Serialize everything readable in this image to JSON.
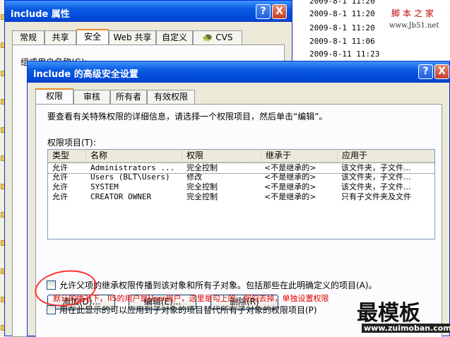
{
  "background_list": {
    "rows": [
      "2009-8-1 11:20",
      "2009-8-1 11:20",
      "2009-8-1 11:06",
      "2009-8-11 11:23"
    ],
    "watermark_text": "脚本之家",
    "watermark_url": "www.Jb51.net"
  },
  "properties_dialog": {
    "title": "include 属性",
    "tabs": [
      "常规",
      "共享",
      "安全",
      "Web 共享",
      "自定义",
      "CVS"
    ],
    "selected_tab": "安全",
    "group_label": "组或用户名称(G):",
    "help_label": "?",
    "close_label": "X"
  },
  "advanced_dialog": {
    "title": "include 的高级安全设置",
    "help_label": "?",
    "close_label": "X",
    "tabs": [
      "权限",
      "审核",
      "所有者",
      "有效权限"
    ],
    "selected_tab": "权限",
    "instructions": "要查看有关特殊权限的详细信息，请选择一个权限项目，然后单击“编辑”。",
    "entries_label": "权限项目(T):",
    "columns": [
      "类型",
      "名称",
      "权限",
      "继承于",
      "应用于"
    ],
    "rows": [
      {
        "type": "允许",
        "name": "Administrators ...",
        "permission": "完全控制",
        "inherited": "<不是继承的>",
        "applies": "该文件夹，子文件..."
      },
      {
        "type": "允许",
        "name": "Users (BLT\\Users)",
        "permission": "修改",
        "inherited": "<不是继承的>",
        "applies": "该文件夹，子文件..."
      },
      {
        "type": "允许",
        "name": "SYSTEM",
        "permission": "完全控制",
        "inherited": "<不是继承的>",
        "applies": "该文件夹，子文件..."
      },
      {
        "type": "允许",
        "name": "CREATOR OWNER",
        "permission": "完全控制",
        "inherited": "<不是继承的>",
        "applies": "只有子文件夹及文件"
      }
    ],
    "buttons": {
      "add": "添加(D)...",
      "edit": "编辑(E)...",
      "remove": "删除(R)"
    },
    "inherit_checkbox_label": "允许父项的继承权限传播到该对象和所有子对象。包括那些在此明确定义的项目(A)。",
    "inherit_checked": false,
    "annotation": "默认的情况下，IIS的用户是User用户，这里是勾上的，把勾去掉，单独设置权限",
    "replace_checkbox_label": "用在此显示的可以应用到子对象的项目替代所有子对象的权限项目(P)",
    "replace_checked": false
  },
  "watermark": {
    "brand": "最模板",
    "url": "www.zuimoban.com"
  },
  "colors": {
    "title_bar": "#0a5ae0",
    "annotation": "#e00000",
    "tab_highlight": "#e68b2c"
  }
}
